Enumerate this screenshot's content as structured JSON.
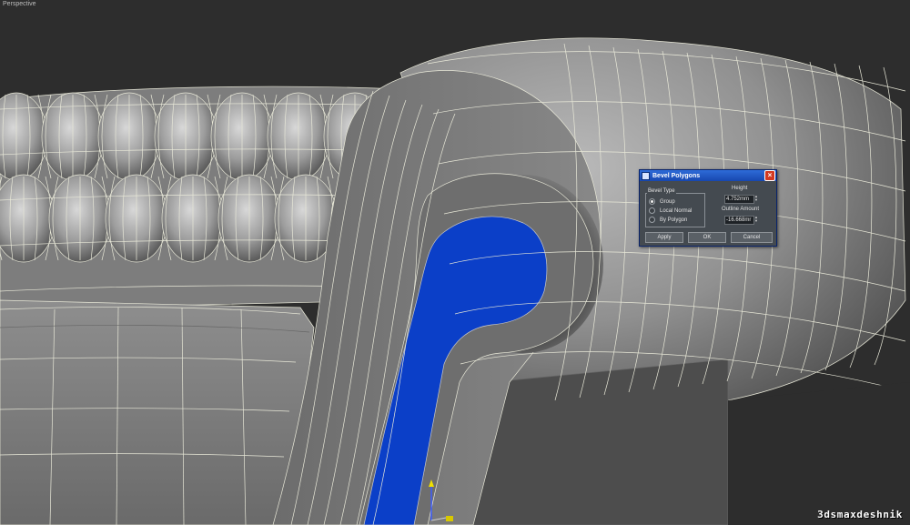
{
  "viewport": {
    "label": "Perspective"
  },
  "watermark": "3dsmaxdeshnik",
  "dialog": {
    "title": "Bevel Polygons",
    "bevel_type_label": "Bevel Type",
    "options": [
      "Group",
      "Local Normal",
      "By Polygon"
    ],
    "selected_option": "Group",
    "height_label": "Height",
    "height_value": "4.752mm",
    "outline_label": "Outline Amount",
    "outline_value": "-16.668mr",
    "buttons": {
      "apply": "Apply",
      "ok": "OK",
      "cancel": "Cancel"
    }
  },
  "colors": {
    "selection": "#0b3fc8",
    "wire": "#e8e8d8",
    "viewport_bg": "#2d2d2d",
    "title_bar": "#1f5ad0"
  }
}
